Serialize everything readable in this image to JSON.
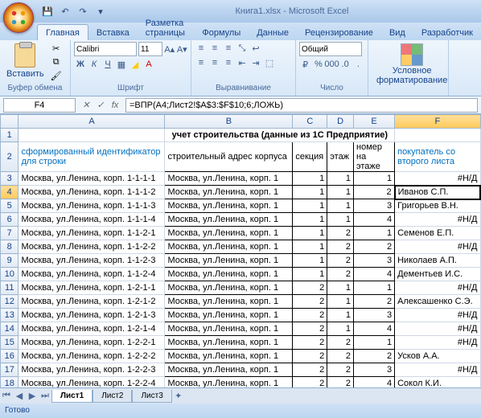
{
  "window": {
    "title": "Книга1.xlsx - Microsoft Excel"
  },
  "qat": {
    "save": "save-icon",
    "undo": "undo-icon",
    "redo": "redo-icon"
  },
  "ribbon": {
    "tabs": [
      "Главная",
      "Вставка",
      "Разметка страницы",
      "Формулы",
      "Данные",
      "Рецензирование",
      "Вид",
      "Разработчик"
    ],
    "active_tab": 0,
    "groups": {
      "clipboard": {
        "label": "Буфер обмена",
        "paste": "Вставить"
      },
      "font": {
        "label": "Шрифт",
        "family": "Calibri",
        "size": "11"
      },
      "align": {
        "label": "Выравнивание"
      },
      "number": {
        "label": "Число",
        "format": "Общий"
      },
      "styles": {
        "cond": "Условное",
        "fmt": "форматирование"
      }
    }
  },
  "namebox": "F4",
  "formula": "=ВПР(A4;Лист2!$A$3:$F$10;6;ЛОЖЬ)",
  "columns": [
    "A",
    "B",
    "C",
    "D",
    "E",
    "F"
  ],
  "sheet_title": "учет строительства (данные из 1С Предприятие)",
  "headers": {
    "A": "сформированный идентификатор для строки",
    "B": "строительный адрес корпуса",
    "C": "секция",
    "D": "этаж",
    "E": "номер на этаже",
    "F": "покупатель со второго листа"
  },
  "rows": [
    {
      "n": 3,
      "a": "Москва, ул.Ленина, корп. 1-1-1-1",
      "b": "Москва, ул.Ленина, корп. 1",
      "c": 1,
      "d": 1,
      "e": 1,
      "f": "#Н/Д"
    },
    {
      "n": 4,
      "a": "Москва, ул.Ленина, корп. 1-1-1-2",
      "b": "Москва, ул.Ленина, корп. 1",
      "c": 1,
      "d": 1,
      "e": 2,
      "f": "Иванов С.П."
    },
    {
      "n": 5,
      "a": "Москва, ул.Ленина, корп. 1-1-1-3",
      "b": "Москва, ул.Ленина, корп. 1",
      "c": 1,
      "d": 1,
      "e": 3,
      "f": "Григорьев В.Н."
    },
    {
      "n": 6,
      "a": "Москва, ул.Ленина, корп. 1-1-1-4",
      "b": "Москва, ул.Ленина, корп. 1",
      "c": 1,
      "d": 1,
      "e": 4,
      "f": "#Н/Д"
    },
    {
      "n": 7,
      "a": "Москва, ул.Ленина, корп. 1-1-2-1",
      "b": "Москва, ул.Ленина, корп. 1",
      "c": 1,
      "d": 2,
      "e": 1,
      "f": "Семенов Е.П."
    },
    {
      "n": 8,
      "a": "Москва, ул.Ленина, корп. 1-1-2-2",
      "b": "Москва, ул.Ленина, корп. 1",
      "c": 1,
      "d": 2,
      "e": 2,
      "f": "#Н/Д"
    },
    {
      "n": 9,
      "a": "Москва, ул.Ленина, корп. 1-1-2-3",
      "b": "Москва, ул.Ленина, корп. 1",
      "c": 1,
      "d": 2,
      "e": 3,
      "f": "Николаев А.П."
    },
    {
      "n": 10,
      "a": "Москва, ул.Ленина, корп. 1-1-2-4",
      "b": "Москва, ул.Ленина, корп. 1",
      "c": 1,
      "d": 2,
      "e": 4,
      "f": "Дементьев И.С."
    },
    {
      "n": 11,
      "a": "Москва, ул.Ленина, корп. 1-2-1-1",
      "b": "Москва, ул.Ленина, корп. 1",
      "c": 2,
      "d": 1,
      "e": 1,
      "f": "#Н/Д"
    },
    {
      "n": 12,
      "a": "Москва, ул.Ленина, корп. 1-2-1-2",
      "b": "Москва, ул.Ленина, корп. 1",
      "c": 2,
      "d": 1,
      "e": 2,
      "f": "Алексашенко С.Э."
    },
    {
      "n": 13,
      "a": "Москва, ул.Ленина, корп. 1-2-1-3",
      "b": "Москва, ул.Ленина, корп. 1",
      "c": 2,
      "d": 1,
      "e": 3,
      "f": "#Н/Д"
    },
    {
      "n": 14,
      "a": "Москва, ул.Ленина, корп. 1-2-1-4",
      "b": "Москва, ул.Ленина, корп. 1",
      "c": 2,
      "d": 1,
      "e": 4,
      "f": "#Н/Д"
    },
    {
      "n": 15,
      "a": "Москва, ул.Ленина, корп. 1-2-2-1",
      "b": "Москва, ул.Ленина, корп. 1",
      "c": 2,
      "d": 2,
      "e": 1,
      "f": "#Н/Д"
    },
    {
      "n": 16,
      "a": "Москва, ул.Ленина, корп. 1-2-2-2",
      "b": "Москва, ул.Ленина, корп. 1",
      "c": 2,
      "d": 2,
      "e": 2,
      "f": "Усков А.А."
    },
    {
      "n": 17,
      "a": "Москва, ул.Ленина, корп. 1-2-2-3",
      "b": "Москва, ул.Ленина, корп. 1",
      "c": 2,
      "d": 2,
      "e": 3,
      "f": "#Н/Д"
    },
    {
      "n": 18,
      "a": "Москва, ул.Ленина, корп. 1-2-2-4",
      "b": "Москва, ул.Ленина, корп. 1",
      "c": 2,
      "d": 2,
      "e": 4,
      "f": "Сокол К.И."
    }
  ],
  "sheets": [
    "Лист1",
    "Лист2",
    "Лист3"
  ],
  "active_sheet": 0,
  "status": "Готово",
  "active_cell": {
    "row": 4,
    "col": "F"
  }
}
